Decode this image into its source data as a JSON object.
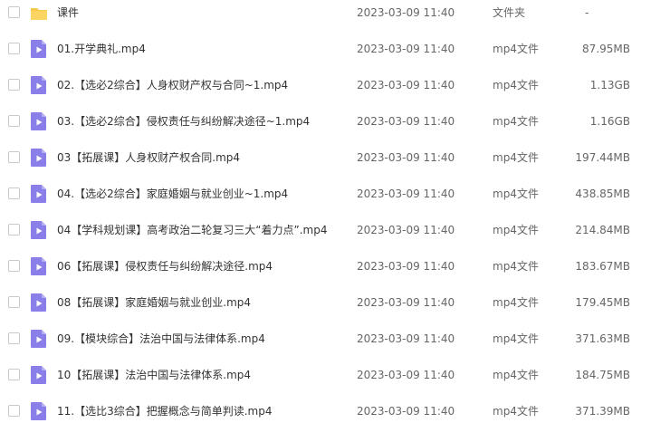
{
  "files": [
    {
      "name": "课件",
      "date": "2023-03-09 11:40",
      "type": "文件夹",
      "size": "-",
      "icon": "folder-icon"
    },
    {
      "name": "01.开学典礼.mp4",
      "date": "2023-03-09 11:40",
      "type": "mp4文件",
      "size": "87.95MB",
      "icon": "video-file-icon"
    },
    {
      "name": "02.【选必2综合】人身权财产权与合同~1.mp4",
      "date": "2023-03-09 11:40",
      "type": "mp4文件",
      "size": "1.13GB",
      "icon": "video-file-icon"
    },
    {
      "name": "03.【选必2综合】侵权责任与纠纷解决途径~1.mp4",
      "date": "2023-03-09 11:40",
      "type": "mp4文件",
      "size": "1.16GB",
      "icon": "video-file-icon"
    },
    {
      "name": "03【拓展课】人身权财产权合同.mp4",
      "date": "2023-03-09 11:40",
      "type": "mp4文件",
      "size": "197.44MB",
      "icon": "video-file-icon"
    },
    {
      "name": "04.【选必2综合】家庭婚姻与就业创业~1.mp4",
      "date": "2023-03-09 11:40",
      "type": "mp4文件",
      "size": "438.85MB",
      "icon": "video-file-icon"
    },
    {
      "name": "04【学科规划课】高考政治二轮复习三大“着力点”.mp4",
      "date": "2023-03-09 11:40",
      "type": "mp4文件",
      "size": "214.84MB",
      "icon": "video-file-icon"
    },
    {
      "name": "06【拓展课】侵权责任与纠纷解决途径.mp4",
      "date": "2023-03-09 11:40",
      "type": "mp4文件",
      "size": "183.67MB",
      "icon": "video-file-icon"
    },
    {
      "name": "08【拓展课】家庭婚姻与就业创业.mp4",
      "date": "2023-03-09 11:40",
      "type": "mp4文件",
      "size": "179.45MB",
      "icon": "video-file-icon"
    },
    {
      "name": "09.【模块综合】法治中国与法律体系.mp4",
      "date": "2023-03-09 11:40",
      "type": "mp4文件",
      "size": "371.63MB",
      "icon": "video-file-icon"
    },
    {
      "name": "10【拓展课】法治中国与法律体系.mp4",
      "date": "2023-03-09 11:40",
      "type": "mp4文件",
      "size": "184.75MB",
      "icon": "video-file-icon"
    },
    {
      "name": "11.【选比3综合】把握概念与简单判读.mp4",
      "date": "2023-03-09 11:40",
      "type": "mp4文件",
      "size": "371.39MB",
      "icon": "video-file-icon"
    }
  ],
  "colors": {
    "folder": "#f7c94b",
    "video": "#8a7fe8",
    "text": "#333333",
    "muted": "#666666"
  }
}
